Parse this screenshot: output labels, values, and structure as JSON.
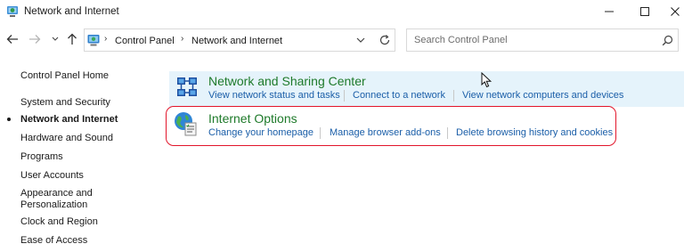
{
  "window": {
    "title": "Network and Internet",
    "icon": "network-internet-icon",
    "controls": [
      "minimize-icon",
      "maximize-icon",
      "close-icon"
    ]
  },
  "navbar": {
    "breadcrumb": [
      "Control Panel",
      "Network and Internet"
    ],
    "search_placeholder": "Search Control Panel"
  },
  "sidebar": {
    "items": [
      {
        "label": "Control Panel Home",
        "current": false
      },
      {
        "label": "System and Security",
        "current": false
      },
      {
        "label": "Network and Internet",
        "current": true
      },
      {
        "label": "Hardware and Sound",
        "current": false
      },
      {
        "label": "Programs",
        "current": false
      },
      {
        "label": "User Accounts",
        "current": false
      },
      {
        "label": "Appearance and Personalization",
        "current": false
      },
      {
        "label": "Clock and Region",
        "current": false
      },
      {
        "label": "Ease of Access",
        "current": false
      }
    ]
  },
  "categories": [
    {
      "title": "Network and Sharing Center",
      "icon": "network-sharing-icon",
      "links": [
        "View network status and tasks",
        "Connect to a network",
        "View network computers and devices"
      ]
    },
    {
      "title": "Internet Options",
      "icon": "internet-options-icon",
      "links": [
        "Change your homepage",
        "Manage browser add-ons",
        "Delete browsing history and cookies"
      ]
    }
  ],
  "colors": {
    "category_title": "#1e7a2a",
    "link": "#1a5ea8",
    "hover_highlight": "#e5f3fb",
    "annotation_outline": "#e2162b"
  }
}
